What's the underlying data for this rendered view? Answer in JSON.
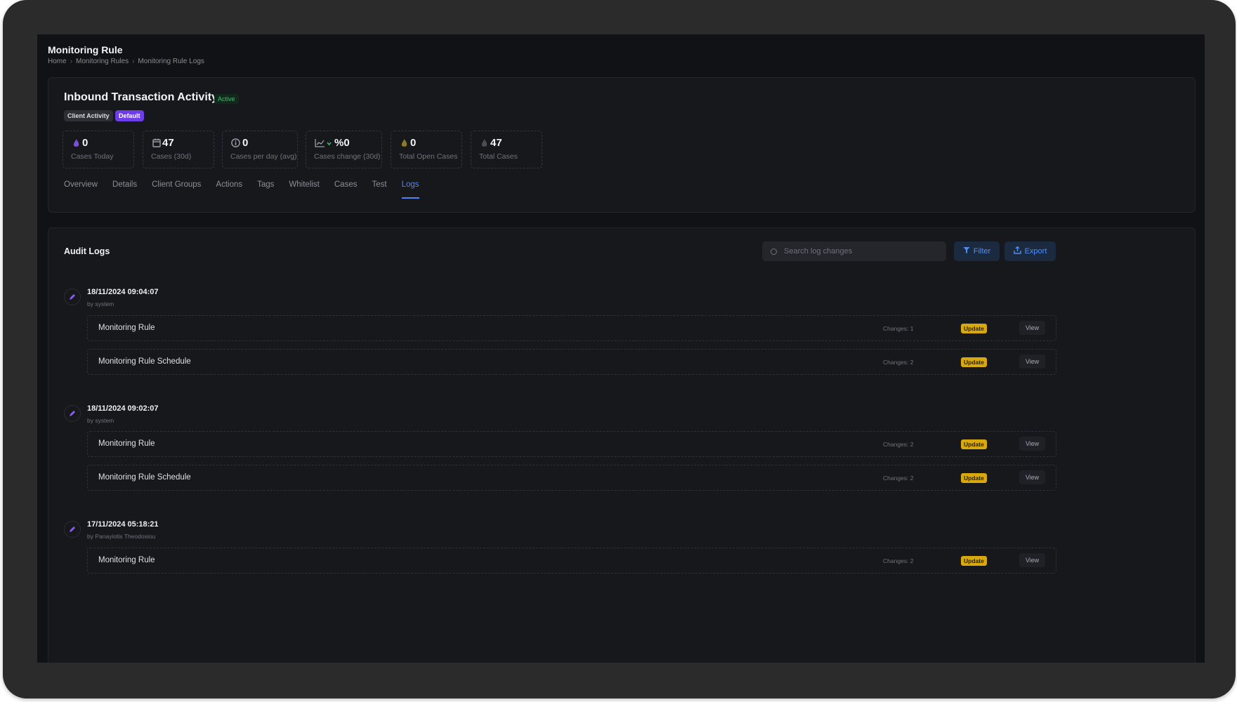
{
  "header": {
    "title": "Monitoring Rule",
    "breadcrumb": [
      "Home",
      "Monitoring Rules",
      "Monitoring Rule Logs"
    ],
    "breadcrumb_sep": "›"
  },
  "rule": {
    "name": "Inbound Transaction Activity",
    "status": "Active",
    "tags": [
      "Client Activity",
      "Default"
    ]
  },
  "stats": [
    {
      "icon": "flame-icon",
      "value": "0",
      "label": "Cases Today"
    },
    {
      "icon": "calendar-icon",
      "value": "47",
      "label": "Cases (30d)"
    },
    {
      "icon": "info-icon",
      "value": "0",
      "label": "Cases per day (avg)"
    },
    {
      "icon": "trend-chart-icon",
      "value": "%0",
      "label": "Cases change (30d)"
    },
    {
      "icon": "flame-icon",
      "value": "0",
      "label": "Total Open Cases"
    },
    {
      "icon": "flame-icon",
      "value": "47",
      "label": "Total Cases"
    }
  ],
  "tabs": [
    "Overview",
    "Details",
    "Client Groups",
    "Actions",
    "Tags",
    "Whitelist",
    "Cases",
    "Test",
    "Logs"
  ],
  "active_tab": "Logs",
  "audit": {
    "title": "Audit Logs",
    "search_placeholder": "Search log changes",
    "filter_label": "Filter",
    "export_label": "Export",
    "entries": [
      {
        "time": "18/11/2024 09:04:07",
        "by": "by system",
        "changes": [
          {
            "name": "Monitoring Rule",
            "count": "Changes: 1",
            "badge": "Update",
            "action": "View"
          },
          {
            "name": "Monitoring Rule Schedule",
            "count": "Changes: 2",
            "badge": "Update",
            "action": "View"
          }
        ]
      },
      {
        "time": "18/11/2024 09:02:07",
        "by": "by system",
        "changes": [
          {
            "name": "Monitoring Rule",
            "count": "Changes: 2",
            "badge": "Update",
            "action": "View"
          },
          {
            "name": "Monitoring Rule Schedule",
            "count": "Changes: 2",
            "badge": "Update",
            "action": "View"
          }
        ]
      },
      {
        "time": "17/11/2024 05:18:21",
        "by": "by Panayiotis Theodosiou",
        "changes": [
          {
            "name": "Monitoring Rule",
            "count": "Changes: 2",
            "badge": "Update",
            "action": "View"
          }
        ]
      }
    ]
  },
  "colors": {
    "accent": "#4f86f7",
    "update_badge": "#d7a90e",
    "default_tag": "#6d3ee8",
    "active_status": "#3fbf6f"
  }
}
